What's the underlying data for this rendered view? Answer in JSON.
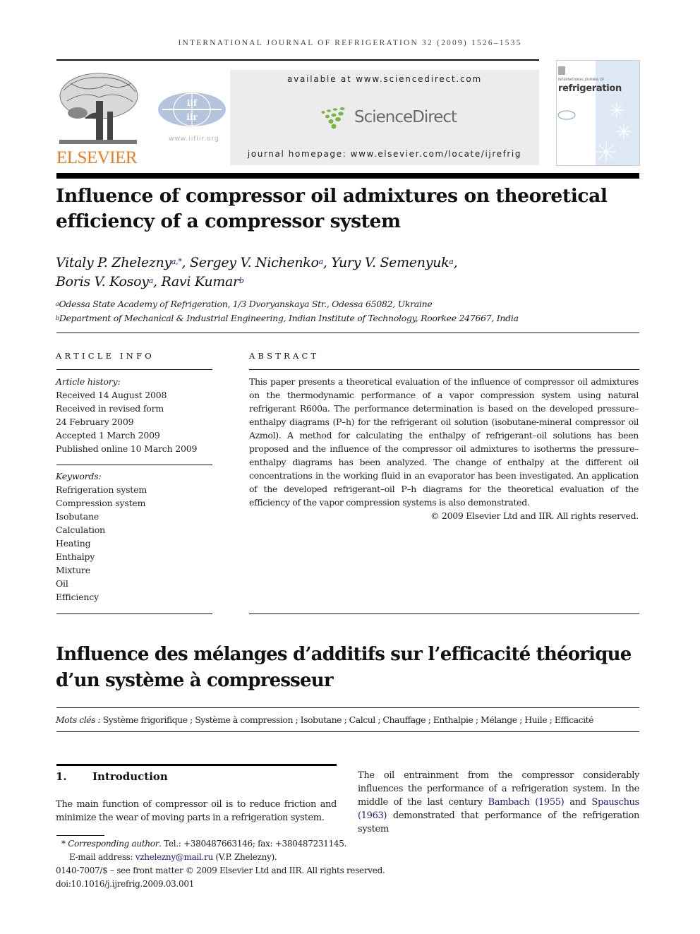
{
  "header": {
    "running_head": "INTERNATIONAL JOURNAL OF REFRIGERATION 32 (2009) 1526–1535",
    "publisher_logo_text": "ELSEVIER",
    "iifiir_logo_text": "iif iir",
    "iifiir_url": "www.iifiir.org",
    "availability": "available at www.sciencedirect.com",
    "sciencedirect_logo_text": "ScienceDirect",
    "journal_homepage": "journal homepage: www.elsevier.com/locate/ijrefrig",
    "cover_title": "refrigeration",
    "cover_subtitle": "INTERNATIONAL JOURNAL OF",
    "colors": {
      "elsevier_orange": "#f07d1a",
      "sciencedirect_green": "#7cb342",
      "iifiir_blue": "#b4c4dc",
      "link_blue": "#1a1a8a"
    }
  },
  "article": {
    "title_line1": "Influence of compressor oil admixtures on theoretical",
    "title_line2": "efficiency of a compressor system",
    "authors": [
      {
        "name": "Vitaly P. Zhelezny",
        "sup": "a,*",
        "sep": ", "
      },
      {
        "name": "Sergey V. Nichenko",
        "sup": "a",
        "sep": ", "
      },
      {
        "name": "Yury V. Semenyuk",
        "sup": "a",
        "sep": ","
      },
      {
        "name": "Boris V. Kosoy",
        "sup": "a",
        "sep": ", "
      },
      {
        "name": "Ravi Kumar",
        "sup": "b",
        "sep": ""
      }
    ],
    "affiliations": [
      {
        "label": "a",
        "text": "Odessa State Academy of Refrigeration, 1/3 Dvoryanskaya Str., Odessa 65082, Ukraine"
      },
      {
        "label": "b",
        "text": "Department of Mechanical & Industrial Engineering, Indian Institute of Technology, Roorkee 247667, India"
      }
    ]
  },
  "article_info": {
    "heading": "ARTICLE INFO",
    "history_label": "Article history:",
    "history": [
      "Received 14 August 2008",
      "Received in revised form",
      "24 February 2009",
      "Accepted 1 March 2009",
      "Published online 10 March 2009"
    ],
    "keywords_label": "Keywords:",
    "keywords": [
      "Refrigeration system",
      "Compression system",
      "Isobutane",
      "Calculation",
      "Heating",
      "Enthalpy",
      "Mixture",
      "Oil",
      "Efficiency"
    ]
  },
  "abstract": {
    "heading": "ABSTRACT",
    "text": "This paper presents a theoretical evaluation of the influence of compressor oil admixtures on the thermodynamic performance of a vapor compression system using natural refrigerant R600a. The performance determination is based on the developed pressure–enthalpy diagrams (P–h) for the refrigerant oil solution (isobutane-mineral compressor oil Azmol). A method for calculating the enthalpy of refrigerant–oil solutions has been proposed and the influence of the compressor oil admixtures to isotherms the pressure–enthalpy diagrams has been analyzed. The change of enthalpy at the different oil concentrations in the working fluid in an evaporator has been investigated. An application of the developed refrigerant–oil P–h diagrams for the theoretical evaluation of the efficiency of the vapor compression systems is also demonstrated.",
    "copyright": "© 2009 Elsevier Ltd and IIR. All rights reserved."
  },
  "french": {
    "title_line1": "Influence des mélanges d’additifs sur l’efficacité théorique",
    "title_line2": "d’un système à compresseur",
    "mots_label": "Mots clés :",
    "mots": "Système frigorifique ; Système à compression ; Isobutane ; Calcul ; Chauffage ; Enthalpie ; Mélange ; Huile ; Efficacité"
  },
  "introduction": {
    "number": "1.",
    "heading": "Introduction",
    "left_text": "The main function of compressor oil is to reduce friction and minimize the wear of moving parts in a refrigeration system.",
    "right_text_1": "The oil entrainment from the compressor considerably influences the performance of a refrigeration system. In the middle of the last century ",
    "ref1": "Bambach (1955)",
    "right_text_2": " and ",
    "ref2": "Spauschus (1963)",
    "right_text_3": " demonstrated that performance of the refrigeration system"
  },
  "footnotes": {
    "star": "*",
    "corresponding_label": "Corresponding author",
    "contact": ". Tel.: +380487663146; fax: +380487231145.",
    "email_label": "E-mail address: ",
    "email": "vzhelezny@mail.ru",
    "email_suffix": " (V.P. Zhelezny).",
    "front_matter": "0140-7007/$ – see front matter © 2009 Elsevier Ltd and IIR. All rights reserved.",
    "doi": "doi:10.1016/j.ijrefrig.2009.03.001"
  }
}
